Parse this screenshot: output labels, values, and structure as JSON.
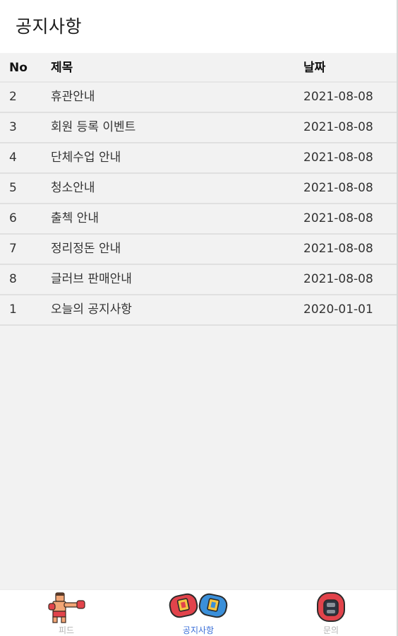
{
  "app_bar": {
    "title": "공지사항"
  },
  "table": {
    "headers": {
      "no": "No",
      "title": "제목",
      "date": "날짜"
    },
    "rows": [
      {
        "no": "2",
        "title": "휴관안내",
        "date": "2021-08-08"
      },
      {
        "no": "3",
        "title": "회원 등록 이벤트",
        "date": "2021-08-08"
      },
      {
        "no": "4",
        "title": "단체수업 안내",
        "date": "2021-08-08"
      },
      {
        "no": "5",
        "title": "청소안내",
        "date": "2021-08-08"
      },
      {
        "no": "6",
        "title": "출첵 안내",
        "date": "2021-08-08"
      },
      {
        "no": "7",
        "title": "정리정돈 안내",
        "date": "2021-08-08"
      },
      {
        "no": "8",
        "title": "글러브 판매안내",
        "date": "2021-08-08"
      },
      {
        "no": "1",
        "title": "오늘의 공지사항",
        "date": "2020-01-01"
      }
    ]
  },
  "bottom_nav": {
    "items": [
      {
        "label": "피드",
        "icon": "boxer-icon",
        "active": false
      },
      {
        "label": "공지사항",
        "icon": "boxing-gloves-icon",
        "active": true
      },
      {
        "label": "문의",
        "icon": "headgear-icon",
        "active": false
      }
    ],
    "active_color": "#3b6fd8",
    "inactive_color": "#b3b3b3"
  }
}
